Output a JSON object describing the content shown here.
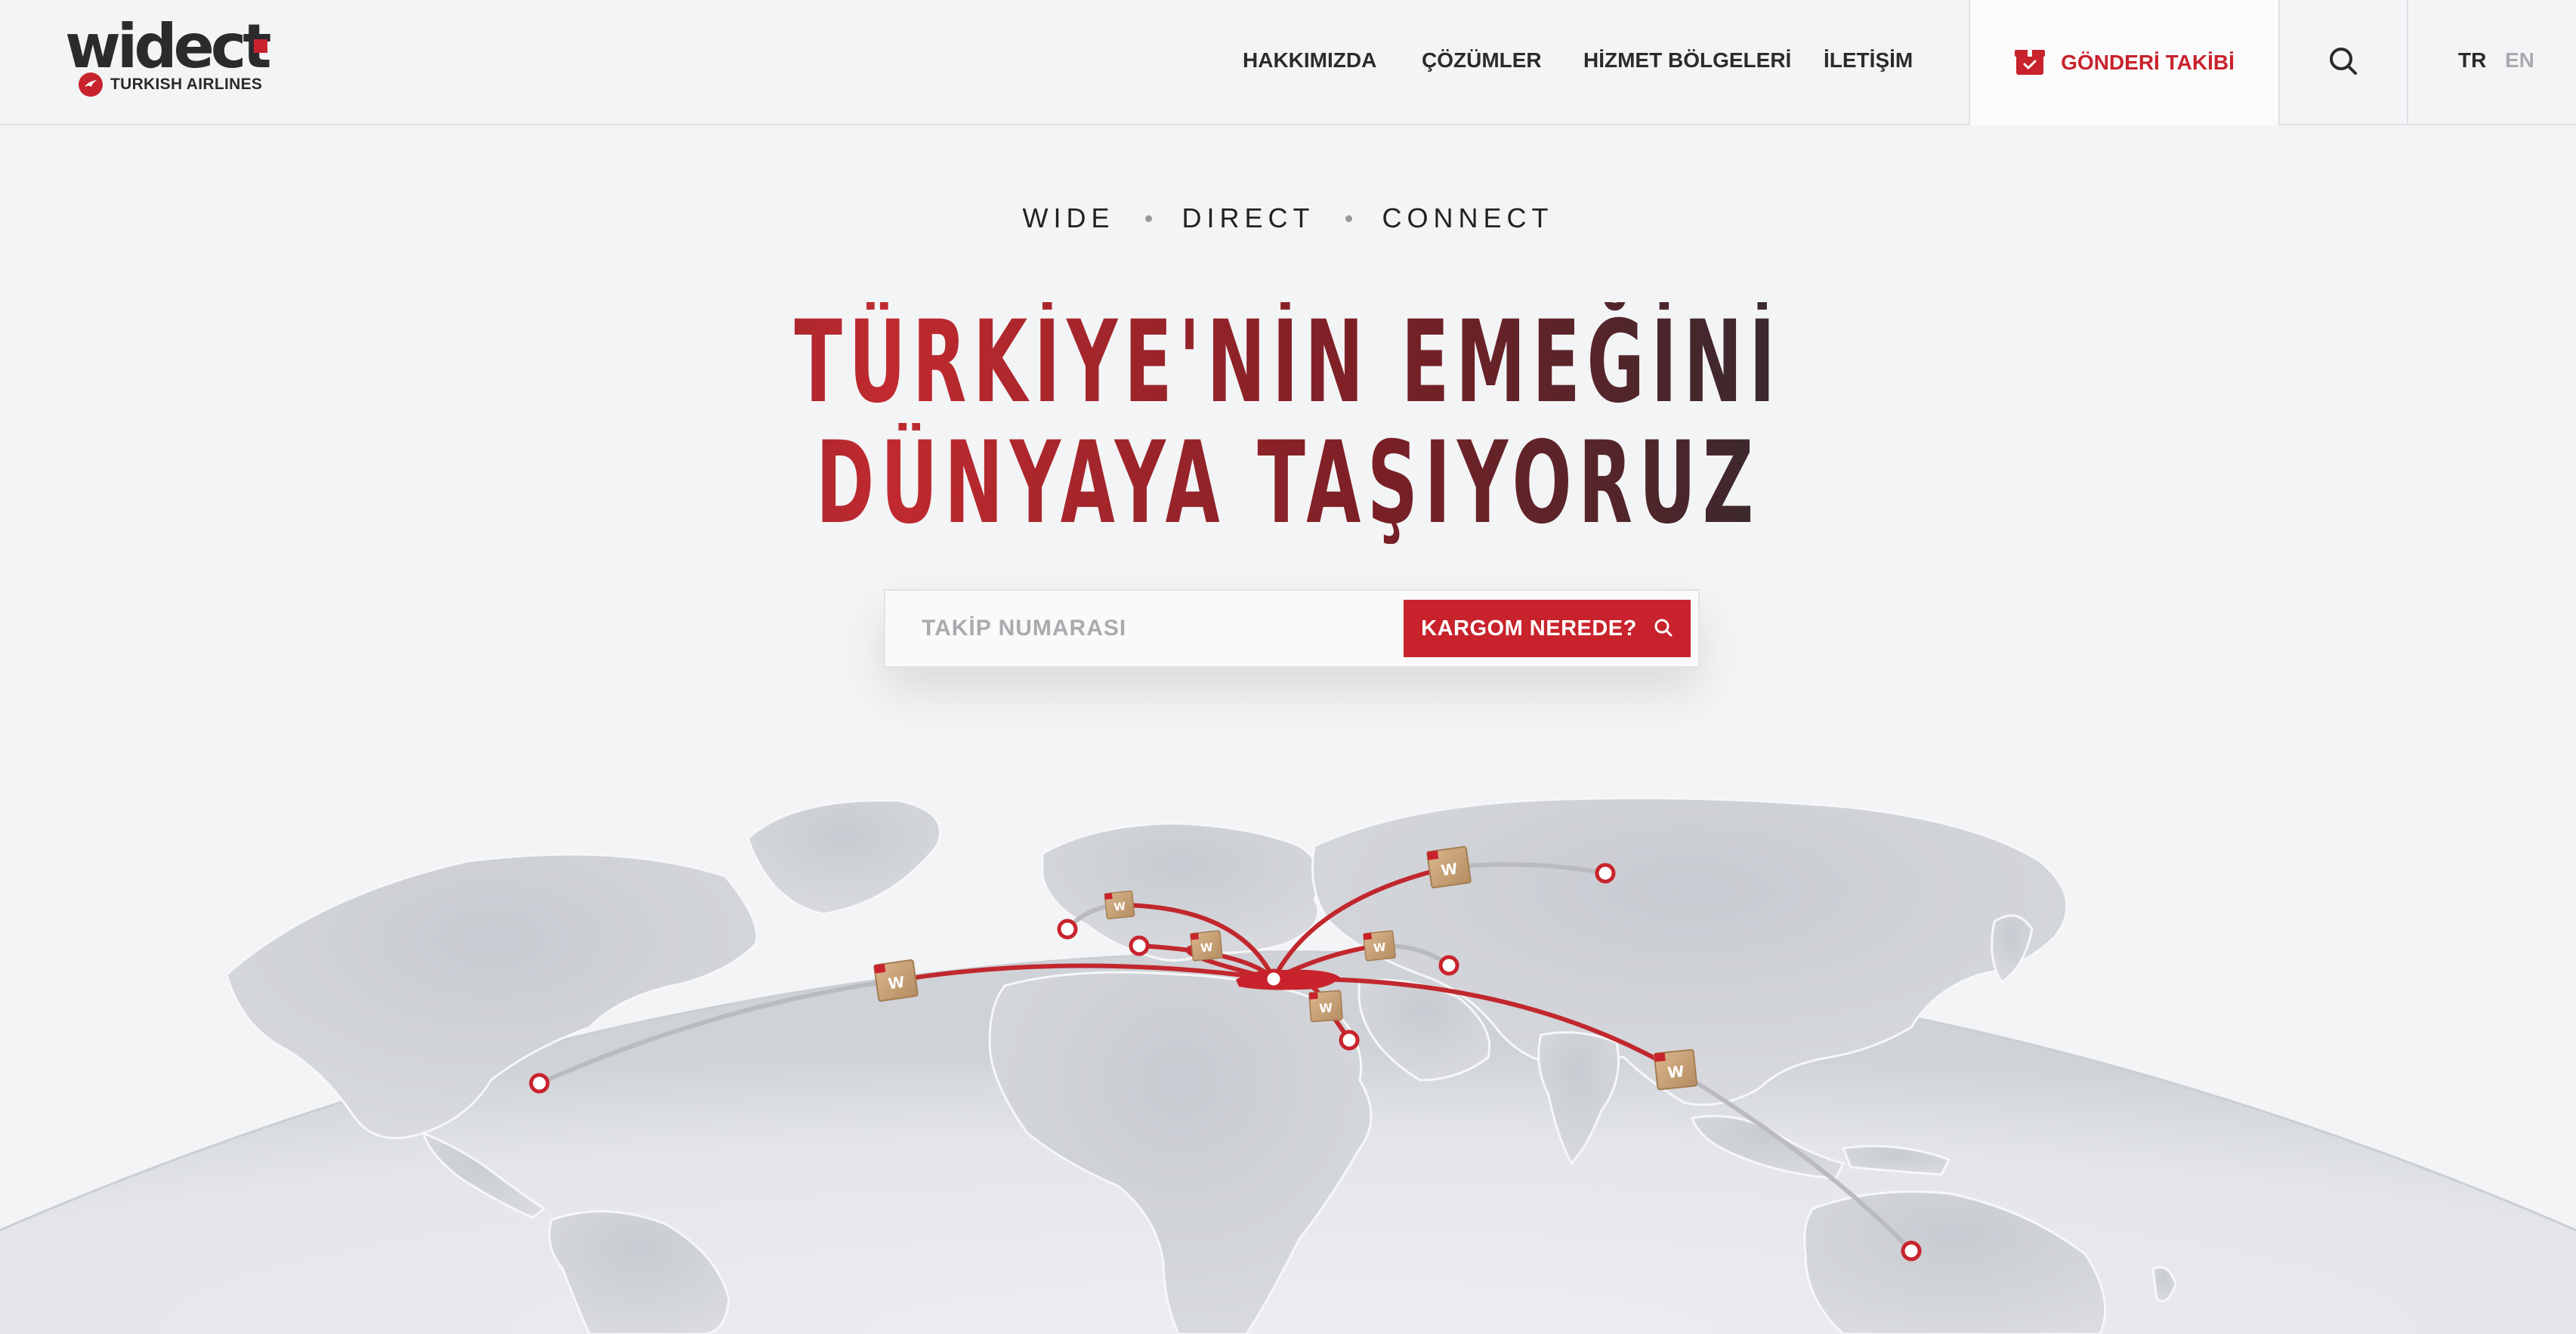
{
  "brand": {
    "logo_text": "widect",
    "partner": "TURKISH AIRLINES",
    "accent": "#c8232c",
    "dark": "#2b2b2e"
  },
  "nav": {
    "items": [
      {
        "label": "HAKKIMIZDA"
      },
      {
        "label": "ÇÖZÜMLER"
      },
      {
        "label": "HİZMET BÖLGELERİ"
      },
      {
        "label": "İLETİŞİM"
      }
    ],
    "tracking_label": "GÖNDERİ TAKİBİ",
    "tracking_icon": "package-icon",
    "search_icon": "search-icon",
    "languages": [
      {
        "code": "TR",
        "active": true
      },
      {
        "code": "EN",
        "active": false
      }
    ]
  },
  "hero": {
    "tagline": [
      "WIDE",
      "DIRECT",
      "CONNECT"
    ],
    "headline_line1": "TÜRKİYE'NİN EMEĞİNİ",
    "headline_line2": "DÜNYAYA TAŞIYORUZ",
    "tracking_placeholder": "TAKİP NUMARASI",
    "tracking_value": "",
    "tracking_button": "KARGOM NEREDE?"
  },
  "map": {
    "package_label": "W",
    "package_count": 8,
    "destination_count": 9
  }
}
